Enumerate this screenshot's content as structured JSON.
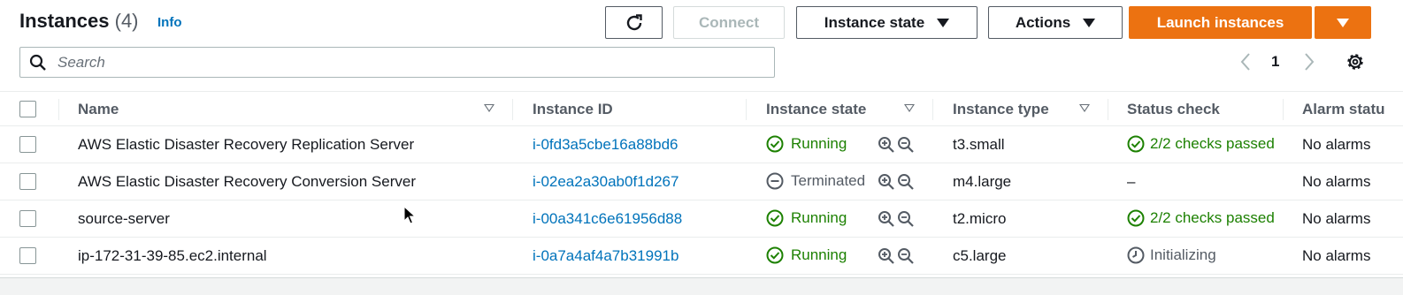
{
  "header": {
    "title": "Instances",
    "count": "(4)",
    "info": "Info",
    "connect_label": "Connect",
    "instance_state_label": "Instance state",
    "actions_label": "Actions",
    "launch_label": "Launch instances"
  },
  "search": {
    "placeholder": "Search"
  },
  "pagination": {
    "current_page": "1"
  },
  "table": {
    "columns": {
      "name": "Name",
      "instance_id": "Instance ID",
      "instance_state": "Instance state",
      "instance_type": "Instance type",
      "status_check": "Status check",
      "alarm_status": "Alarm statu"
    },
    "rows": [
      {
        "name": "AWS Elastic Disaster Recovery Replication Server",
        "instance_id": "i-0fd3a5cbe16a88bd6",
        "state": "Running",
        "type": "t3.small",
        "status": "2/2 checks passed",
        "alarm": "No alarms"
      },
      {
        "name": "AWS Elastic Disaster Recovery Conversion Server",
        "instance_id": "i-02ea2a30ab0f1d267",
        "state": "Terminated",
        "type": "m4.large",
        "status": "–",
        "alarm": "No alarms"
      },
      {
        "name": "source-server",
        "instance_id": "i-00a341c6e61956d88",
        "state": "Running",
        "type": "t2.micro",
        "status": "2/2 checks passed",
        "alarm": "No alarms"
      },
      {
        "name": "ip-172-31-39-85.ec2.internal",
        "instance_id": "i-0a7a4af4a7b31991b",
        "state": "Running",
        "type": "c5.large",
        "status": "Initializing",
        "alarm": "No alarms"
      }
    ]
  },
  "colors": {
    "accent_orange": "#ec7211",
    "link_blue": "#0073bb",
    "success_green": "#1d8102"
  }
}
